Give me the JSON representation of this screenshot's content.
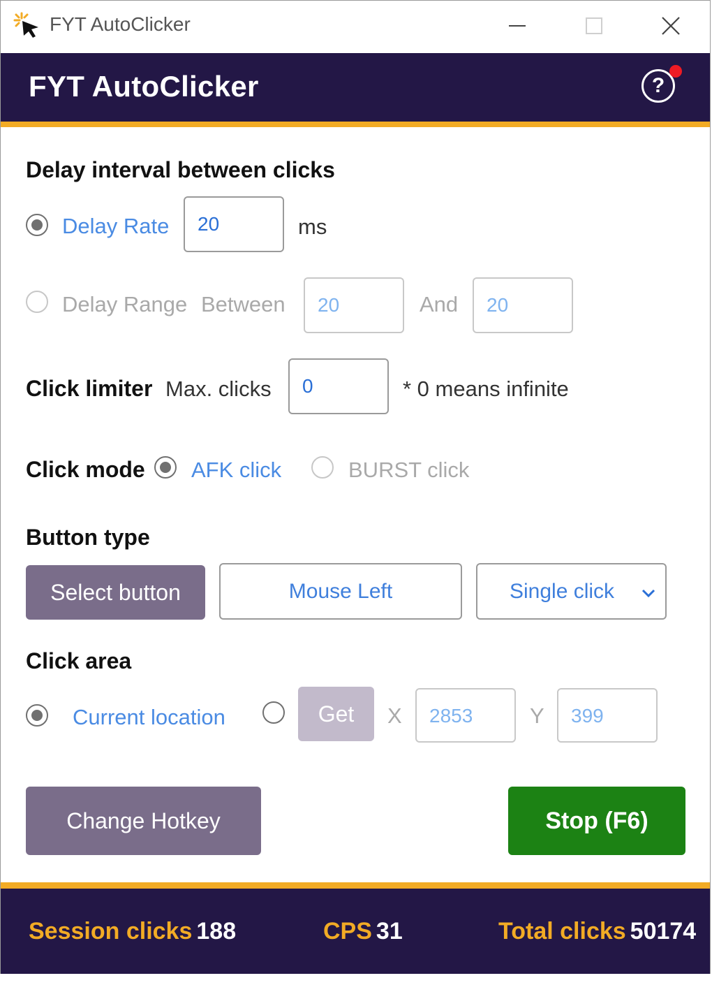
{
  "window": {
    "title": "FYT AutoClicker"
  },
  "header": {
    "title": "FYT AutoClicker"
  },
  "delay": {
    "section_title": "Delay interval between clicks",
    "rate_label": "Delay Rate",
    "rate_value": "20",
    "rate_unit": "ms",
    "range_label": "Delay Range",
    "between_label": "Between",
    "range_from": "20",
    "and_label": "And",
    "range_to": "20",
    "selected": "Delay Rate"
  },
  "limiter": {
    "section_title": "Click limiter",
    "max_label": "Max. clicks",
    "max_value": "0",
    "note": "* 0 means infinite"
  },
  "mode": {
    "section_title": "Click mode",
    "afk_label": "AFK click",
    "burst_label": "BURST click",
    "selected": "AFK click"
  },
  "button_type": {
    "section_title": "Button type",
    "select_button": "Select button",
    "mouse_button": "Mouse Left",
    "click_type": "Single click"
  },
  "area": {
    "section_title": "Click area",
    "current_label": "Current location",
    "get_button": "Get",
    "x_label": "X",
    "x_value": "2853",
    "y_label": "Y",
    "y_value": "399",
    "selected": "Current location"
  },
  "actions": {
    "hotkey_button": "Change Hotkey",
    "stop_button": "Stop (F6)"
  },
  "footer": {
    "session_label": "Session clicks",
    "session_value": "188",
    "cps_label": "CPS",
    "cps_value": "31",
    "total_label": "Total clicks",
    "total_value": "50174"
  },
  "colors": {
    "header_bg": "#231746",
    "accent_gold": "#f2ab25",
    "button_purple": "#7a6d8a",
    "stop_green": "#1c8214",
    "link_blue": "#4a8be3"
  }
}
